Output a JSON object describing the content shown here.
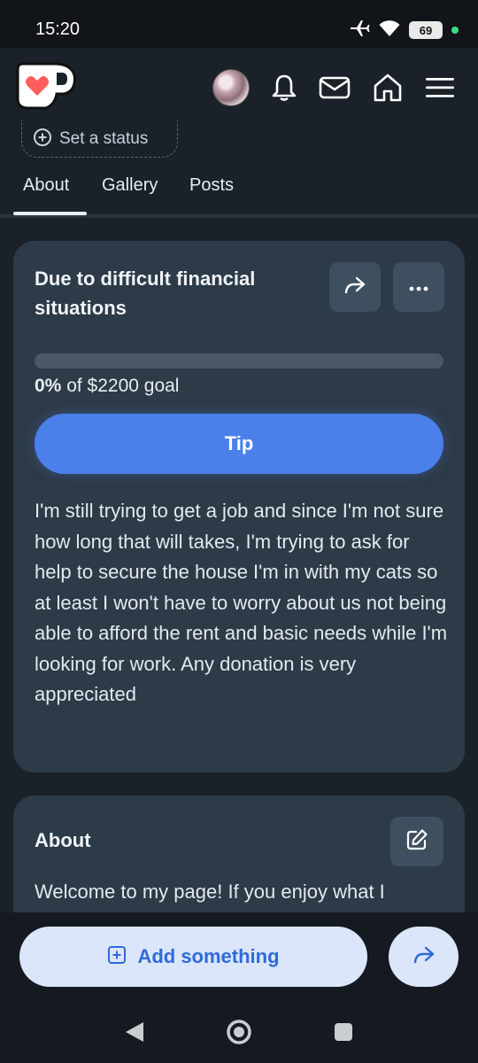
{
  "status_bar": {
    "time": "15:20",
    "battery": "69"
  },
  "header": {
    "icons": [
      "ko-fi-logo",
      "avatar",
      "bell-icon",
      "mail-icon",
      "home-icon",
      "menu-icon"
    ]
  },
  "profile": {
    "set_status_label": "Set a status"
  },
  "tabs": [
    {
      "label": "About",
      "active": true
    },
    {
      "label": "Gallery",
      "active": false
    },
    {
      "label": "Posts",
      "active": false
    }
  ],
  "goal_card": {
    "title": "Due to difficult financial situations",
    "progress_percent": 0,
    "progress_label_bold": "0%",
    "progress_label_rest": " of $2200 goal",
    "tip_label": "Tip",
    "description": "I'm still trying to get a job and since I'm not sure how long that will takes, I'm trying to ask for help to secure the house I'm in with my cats so at least I won't have to worry about us not being able to afford the rent and basic needs while I'm looking for work. Any donation is very appreciated"
  },
  "about_card": {
    "title": "About",
    "text": "Welcome to my page! If you enjoy what I"
  },
  "bottom": {
    "add_label": "Add something"
  },
  "colors": {
    "accent": "#4b7fea",
    "card_bg": "#2d3a47",
    "page_bg": "#1a2129",
    "logo_red": "#ff5e5b"
  }
}
